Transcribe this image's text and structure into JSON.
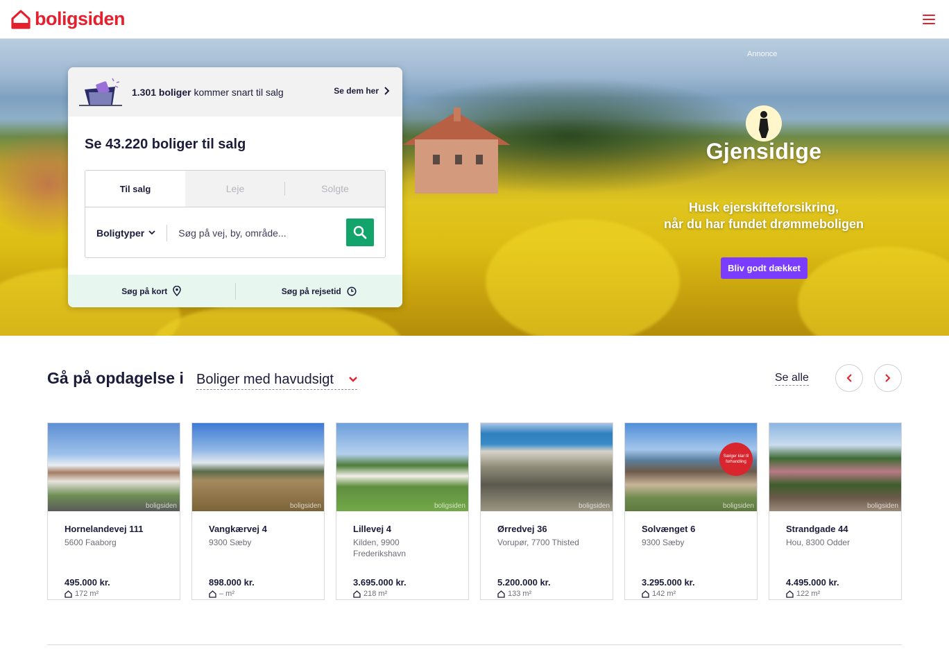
{
  "header": {
    "logo_text": "boligsiden",
    "brand_color": "#e4202f"
  },
  "hero": {
    "annonce": "Annonce",
    "ad_brand": "Gjensidige",
    "ad_text_line1": "Husk ejerskifteforsikring,",
    "ad_text_line2": "når du har fundet drømmeboligen",
    "ad_cta": "Bliv godt dækket",
    "ad_cta_color": "#7a3dff"
  },
  "search": {
    "soon_count": "1.301 boliger",
    "soon_text": " kommer snart til salg",
    "soon_link": "Se dem her",
    "title": "Se 43.220 boliger til salg",
    "tabs": [
      {
        "label": "Til salg"
      },
      {
        "label": "Leje"
      },
      {
        "label": "Solgte"
      }
    ],
    "boligtyper_label": "Boligtyper",
    "placeholder": "Søg på vej, by, område...",
    "search_button_color": "#12a46a",
    "map_link": "Søg på kort",
    "travel_link": "Søg på rejsetid"
  },
  "discover": {
    "title": "Gå på opdagelse i",
    "selected_option": "Boliger med havudsigt",
    "see_all": "Se alle"
  },
  "listings": [
    {
      "street": "Hornelandevej 111",
      "city": "5600 Faaborg",
      "price": "495.000 kr.",
      "size": "172 m²"
    },
    {
      "street": "Vangkærvej 4",
      "city": "9300 Sæby",
      "price": "898.000 kr.",
      "size": "– m²"
    },
    {
      "street": "Lillevej 4",
      "city": "Kilden, 9900 Frederikshavn",
      "price": "3.695.000 kr.",
      "size": "218 m²"
    },
    {
      "street": "Ørredvej 36",
      "city": "Vorupør, 7700 Thisted",
      "price": "5.200.000 kr.",
      "size": "133 m²"
    },
    {
      "street": "Solvænget 6",
      "city": "9300 Sæby",
      "price": "3.295.000 kr.",
      "size": "142 m²",
      "badge": "Sælger klar til forhandling"
    },
    {
      "street": "Strandgade 44",
      "city": "Hou, 8300 Odder",
      "price": "4.495.000 kr.",
      "size": "122 m²"
    }
  ],
  "watermark": "boligsiden"
}
